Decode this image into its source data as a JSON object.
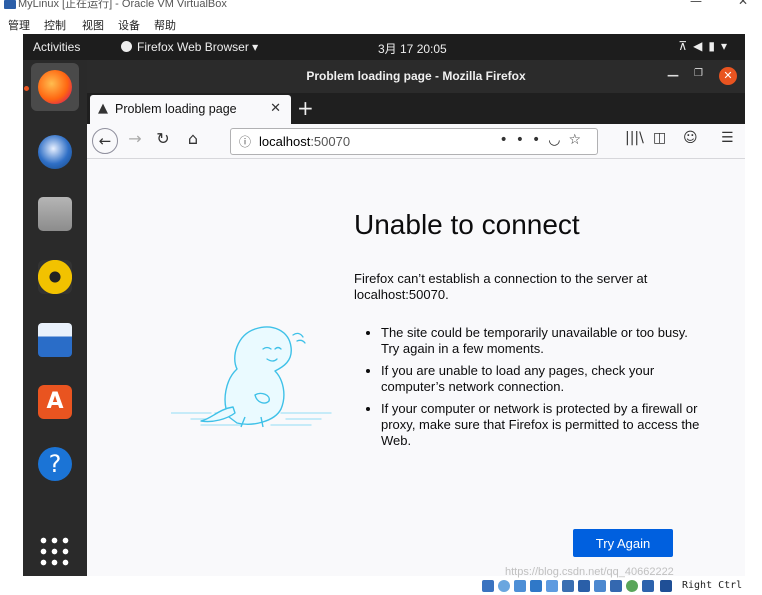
{
  "vbox": {
    "window_title": "MyLinux [正在运行] - Oracle VM VirtualBox",
    "menu": [
      "管理",
      "控制",
      "视图",
      "设备",
      "帮助"
    ],
    "host_key": "Right Ctrl"
  },
  "topbar": {
    "activities": "Activities",
    "app_name": "Firefox Web Browser",
    "clock": "3月 17  20:05"
  },
  "dock": {
    "items": [
      {
        "name": "firefox",
        "color": "#e66000"
      },
      {
        "name": "thunderbird",
        "color": "#2f6fc6"
      },
      {
        "name": "files",
        "color": "#9c9c9c"
      },
      {
        "name": "rhythmbox",
        "color": "#f2c200"
      },
      {
        "name": "libreoffice-writer",
        "color": "#2a6dc8"
      },
      {
        "name": "ubuntu-software",
        "color": "#e95420"
      },
      {
        "name": "help",
        "color": "#1b74d6"
      }
    ]
  },
  "firefox": {
    "window_title": "Problem loading page - Mozilla Firefox",
    "tab_label": "Problem loading page",
    "url_host": "localhost",
    "url_port": ":50070",
    "heading": "Unable to connect",
    "description": "Firefox can’t establish a connection to the server at localhost:50070.",
    "bullets": [
      "The site could be temporarily unavailable or too busy. Try again in a few moments.",
      "If you are unable to load any pages, check your computer’s network connection.",
      "If your computer or network is protected by a firewall or proxy, make sure that Firefox is permitted to access the Web."
    ],
    "try_again": "Try Again"
  },
  "watermark": "https://blog.csdn.net/qq_40662222",
  "colors": {
    "accent": "#0060df",
    "ubuntu_orange": "#e95420",
    "topbar_bg": "#1d1d1d"
  }
}
